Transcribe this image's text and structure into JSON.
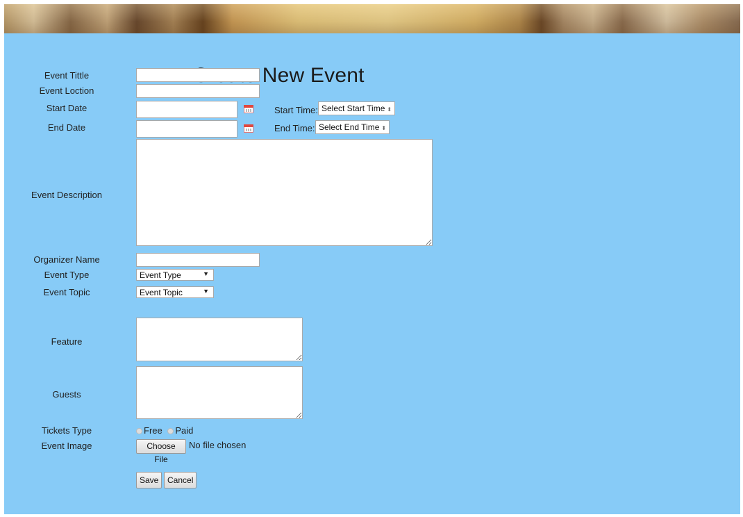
{
  "page": {
    "title": "Create New Event",
    "colors": {
      "panel": "#87cbf7",
      "input_bg": "#ffffff"
    }
  },
  "form": {
    "event_title_label": "Event Tittle",
    "event_location_label": "Event Loction",
    "start_date_label": "Start Date",
    "end_date_label": "End Date",
    "start_time_label": "Start Time:",
    "start_time_value": "Select Start Time",
    "end_time_label": "End Time:",
    "end_time_value": "Select End Time",
    "description_label": "Event Description",
    "organizer_label": "Organizer Name",
    "event_type_label": "Event Type",
    "event_type_value": "Event Type",
    "event_topic_label": "Event Topic",
    "event_topic_value": "Event Topic",
    "feature_label": "Feature",
    "guests_label": "Guests",
    "tickets_label": "Tickets Type",
    "ticket_free": "Free",
    "ticket_paid": "Paid",
    "image_label": "Event Image",
    "choose_file": "Choose File",
    "no_file": "No file chosen",
    "save": "Save",
    "cancel": "Cancel"
  },
  "icons": {
    "calendar": "calendar-icon",
    "spinner": "spinner-arrows-icon",
    "dropdown": "caret-down-icon"
  }
}
